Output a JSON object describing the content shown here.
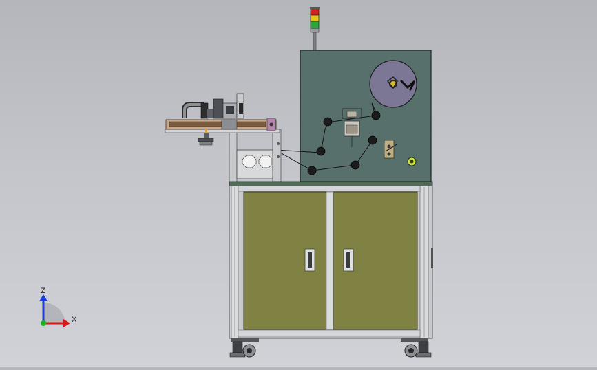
{
  "viewport": {
    "background_top": "#b4b6bc",
    "background_bottom": "#d0d2d7"
  },
  "triad": {
    "z_label": "Z",
    "x_label": "X",
    "z_color": "#1a3fd6",
    "x_color": "#d61a1a",
    "origin_color": "#18b418"
  },
  "machine": {
    "panel_color": "#58706c",
    "door_color": "#808243",
    "frame_color": "#c7c9cc",
    "reel_color": "#7c7794",
    "signal_tower": [
      "#d32020",
      "#e3c41a",
      "#2aa83a"
    ],
    "accent_orange": "#e29a2a",
    "accent_green": "#c6e23a"
  }
}
